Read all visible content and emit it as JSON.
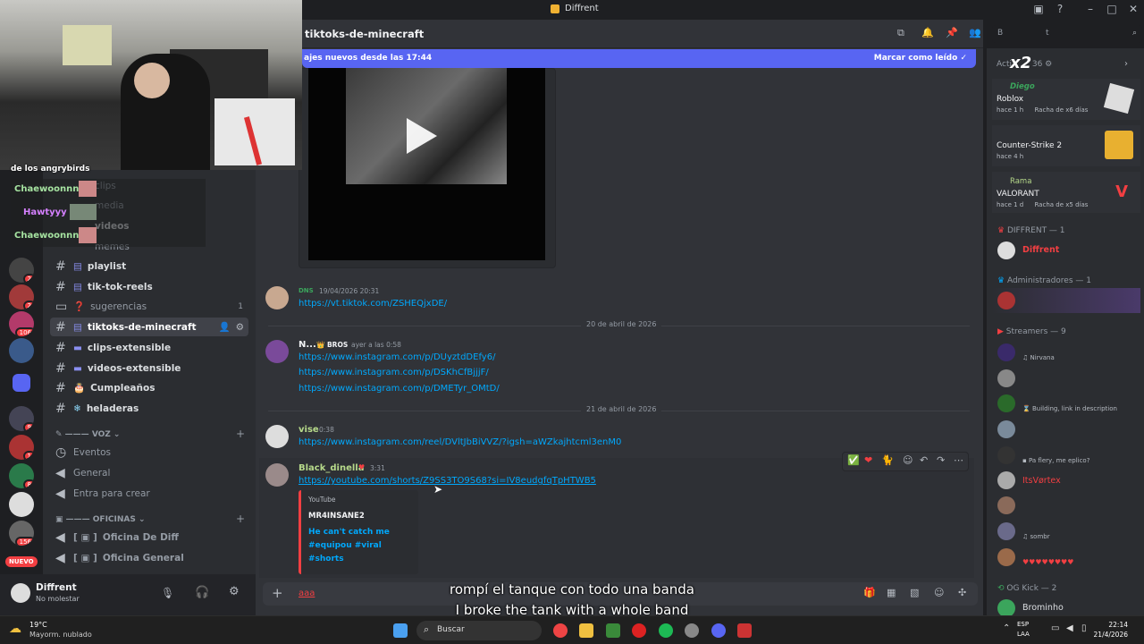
{
  "window": {
    "title": "Diffrent"
  },
  "webcam": {
    "caption": "de los angrybirds"
  },
  "stream_chat": [
    {
      "user": "Chaewoonnn :",
      "color": "#a6e3a1"
    },
    {
      "user": "Hawtyyy :",
      "color": "#d580ff"
    },
    {
      "user": "Chaewoonnn :",
      "color": "#a6e3a1"
    }
  ],
  "channels": {
    "items": [
      {
        "label": "clips"
      },
      {
        "label": "media"
      },
      {
        "label": "videos"
      },
      {
        "label": "memes"
      },
      {
        "label": "playlist",
        "emoji": "▤"
      },
      {
        "label": "tik-tok-reels",
        "emoji": "▤"
      },
      {
        "label": "sugerencias",
        "emoji": "❓",
        "count": "1"
      },
      {
        "label": "tiktoks-de-minecraft",
        "emoji": "▤"
      },
      {
        "label": "clips-extensible",
        "emoji": "▬"
      },
      {
        "label": "videos-extensible",
        "emoji": "▬"
      },
      {
        "label": "Cumpleaños",
        "emoji": "🎂"
      },
      {
        "label": "heladeras",
        "emoji": "❄"
      }
    ],
    "voice_category": "VOZ",
    "voice": [
      {
        "label": "Eventos"
      },
      {
        "label": "General"
      },
      {
        "label": "Entra para crear"
      }
    ],
    "office_category": "OFICINAS",
    "offices": [
      {
        "label": "Oficina De Diff"
      },
      {
        "label": "Oficina General"
      }
    ]
  },
  "servers": {
    "badges": [
      "2",
      "2",
      "106",
      "9",
      "1",
      "8",
      "156"
    ],
    "new_label": "NUEVO"
  },
  "user": {
    "name": "Diffrent",
    "status": "No molestar"
  },
  "header": {
    "channel": "tiktoks-de-minecraft",
    "search_placeholder": "B",
    "search_suffix": "t"
  },
  "new_messages": {
    "text": "ajes nuevos desde las 17:44",
    "action": "Marcar como leído"
  },
  "messages": [
    {
      "badge": "DNS",
      "time": "19/04/2026 20:31",
      "links": [
        "https://vt.tiktok.com/ZSHEQjxDE/"
      ]
    },
    {
      "user": "N...",
      "tag": "BROS",
      "time": "ayer a las 0:58",
      "links": [
        "https://www.instagram.com/p/DUyztdDEfy6/",
        "https://www.instagram.com/p/DSKhCfBjjjF/",
        "https://www.instagram.com/p/DMETyr_OMtD/"
      ]
    },
    {
      "user": "vise",
      "time": "0:38",
      "links": [
        "https://www.instagram.com/reel/DVltJbBiVVZ/?igsh=aWZkajhtcml3enM0"
      ]
    },
    {
      "user": "Black_dinella",
      "time": "3:31",
      "links": [
        "https://youtube.com/shorts/Z9SS3TO9S68?si=IV8eudgfqTpHTWB5"
      ]
    }
  ],
  "dates": [
    "20 de abril de 2026",
    "21 de abril de 2026"
  ],
  "embed": {
    "provider": "YouTube",
    "author": "MR4INSANE2",
    "title_lines": [
      "He can't catch me",
      "#equipou #viral",
      "#shorts"
    ]
  },
  "composer": {
    "value": "aaa"
  },
  "subtitles": [
    "rompí el tanque con todo una banda",
    "I broke the tank with a whole band"
  ],
  "members": {
    "activity_header": "Acti",
    "activity_count": "36",
    "overlay_badge": "x2",
    "activities": [
      {
        "user": "Diego",
        "game": "Roblox",
        "meta": "hace 1 h",
        "streak": "Racha de x6 días"
      },
      {
        "game": "Counter-Strike 2",
        "meta": "hace 4 h"
      },
      {
        "user": "Rama",
        "game": "VALORANT",
        "meta": "hace 1 d",
        "streak": "Racha de x5 días"
      }
    ],
    "groups": [
      {
        "label": "DIFFRENT — 1"
      },
      {
        "label": "Administradores — 1"
      },
      {
        "label": "Streamers — 9"
      },
      {
        "label": "OG Kick — 2"
      }
    ],
    "member_names": [
      "Diffrent",
      "ItsVørtex",
      "Brominho"
    ],
    "statuses": [
      "Nirvana",
      "Building, link in description",
      "Pa flery, me eplico?",
      "sombr"
    ]
  },
  "taskbar": {
    "weather_temp": "19°C",
    "weather_desc": "Mayorm. nublado",
    "search": "Buscar",
    "lang": "ESP",
    "lang2": "LAA",
    "time": "22:14",
    "date": "21/4/2026"
  }
}
